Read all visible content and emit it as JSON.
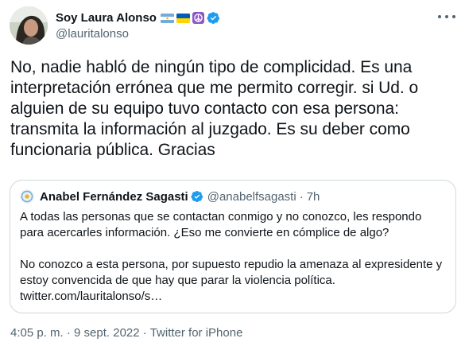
{
  "author": {
    "display_name": "Soy Laura Alonso",
    "handle": "@lauritalonso",
    "badges": [
      "flag-argentina-icon",
      "flag-ukraine-icon",
      "peace-icon",
      "verified-icon"
    ]
  },
  "tweet": {
    "text": "No, nadie habló de ningún tipo de complicidad. Es una interpretación errónea que me permito corregir. si Ud. o alguien de su equipo tuvo contacto con esa persona: transmita la información al juzgado. Es su deber como funcionaria pública. Gracias"
  },
  "quoted": {
    "display_name": "Anabel Fernández Sagasti",
    "handle": "@anabelfsagasti",
    "separator": "·",
    "time": "7h",
    "paragraph_1": "A todas las personas que se contactan conmigo y no conozco, les respondo para acercarles información. ¿Eso me convierte en cómplice de algo?",
    "paragraph_2": "No conozco a esta persona, por supuesto repudio la amenaza al expresidente y estoy convencida de que hay que parar la violencia política.",
    "link": "twitter.com/lauritalonso/s…"
  },
  "footer": {
    "time": "4:05 p. m.",
    "separator": "·",
    "date": "9 sept. 2022",
    "source": "Twitter for iPhone"
  },
  "colors": {
    "text": "#0f1419",
    "secondary": "#536471",
    "verified": "#1d9bf0",
    "border": "#cfd9de",
    "peace": "#8e57c7"
  }
}
